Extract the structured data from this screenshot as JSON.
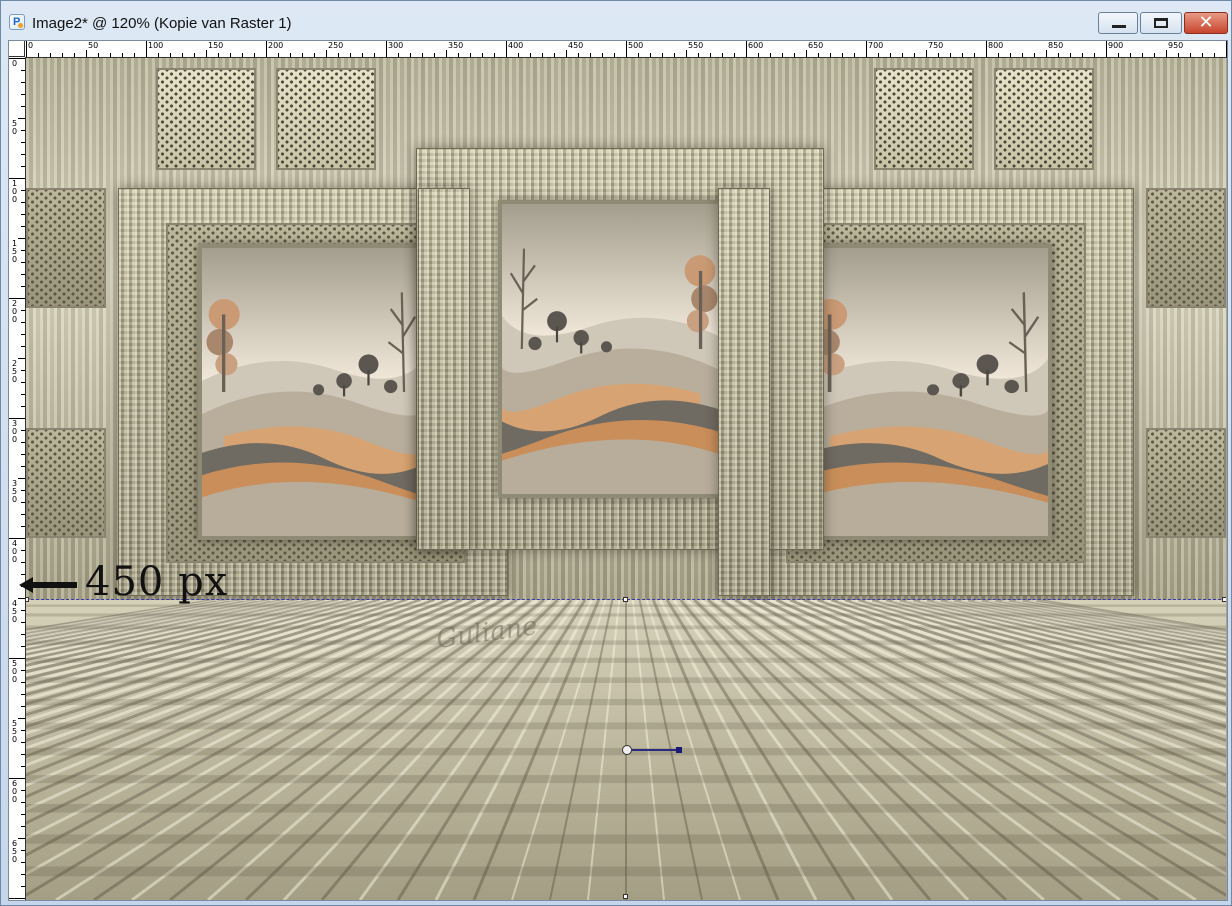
{
  "window": {
    "title": "Image2* @ 120% (Kopie van Raster 1)",
    "app_icon": "paintshop-pro-icon",
    "controls": [
      "minimize-icon",
      "maximize-icon",
      "close-icon"
    ],
    "close_glyph": "✕"
  },
  "rulers": {
    "horizontal_labels": [
      "0",
      "50",
      "100",
      "150",
      "200",
      "250",
      "300",
      "350",
      "400",
      "450",
      "500",
      "550",
      "600",
      "650",
      "700",
      "750",
      "800",
      "850",
      "900",
      "950"
    ],
    "vertical_labels": [
      "0",
      "50",
      "100",
      "150",
      "200",
      "250",
      "300",
      "350",
      "400",
      "450",
      "500",
      "550",
      "600",
      "650"
    ]
  },
  "canvas": {
    "annotation_text": "450 px",
    "annotation_icon": "left-arrow-icon",
    "watermark": "Guliane",
    "colors": {
      "wall": "#cfc9ad",
      "floor": "#b9b49a",
      "frame": "#9f997f",
      "selection": "#3a3ab0"
    }
  }
}
